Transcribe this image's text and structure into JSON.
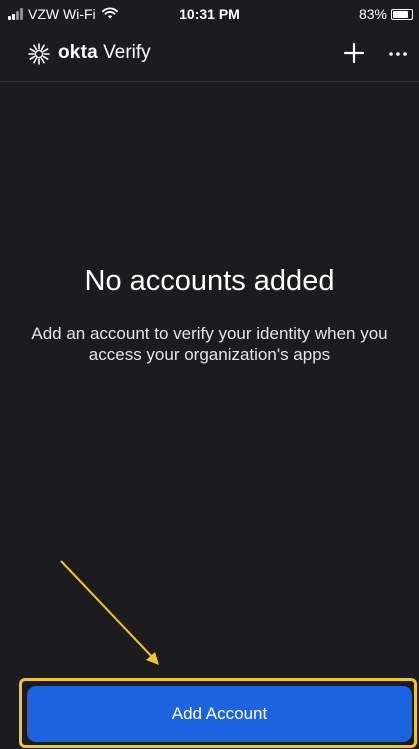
{
  "status_bar": {
    "carrier": "VZW Wi-Fi",
    "time": "10:31 PM",
    "battery_percent": "83%",
    "battery_level": 0.83,
    "icons": [
      "signal-icon",
      "wifi-icon",
      "battery-icon"
    ]
  },
  "header": {
    "logo_brand": "okta",
    "logo_product": "Verify",
    "logo_icon": "okta-sunburst-icon",
    "add_icon": "plus-icon",
    "more_icon": "ellipsis-icon"
  },
  "empty_state": {
    "title": "No accounts added",
    "description": "Add an account to verify your identity when you access your organization's apps"
  },
  "footer": {
    "add_account_label": "Add Account"
  },
  "colors": {
    "background": "#1c1c1e",
    "button": "#1d63e0",
    "highlight": "#f2c335"
  }
}
